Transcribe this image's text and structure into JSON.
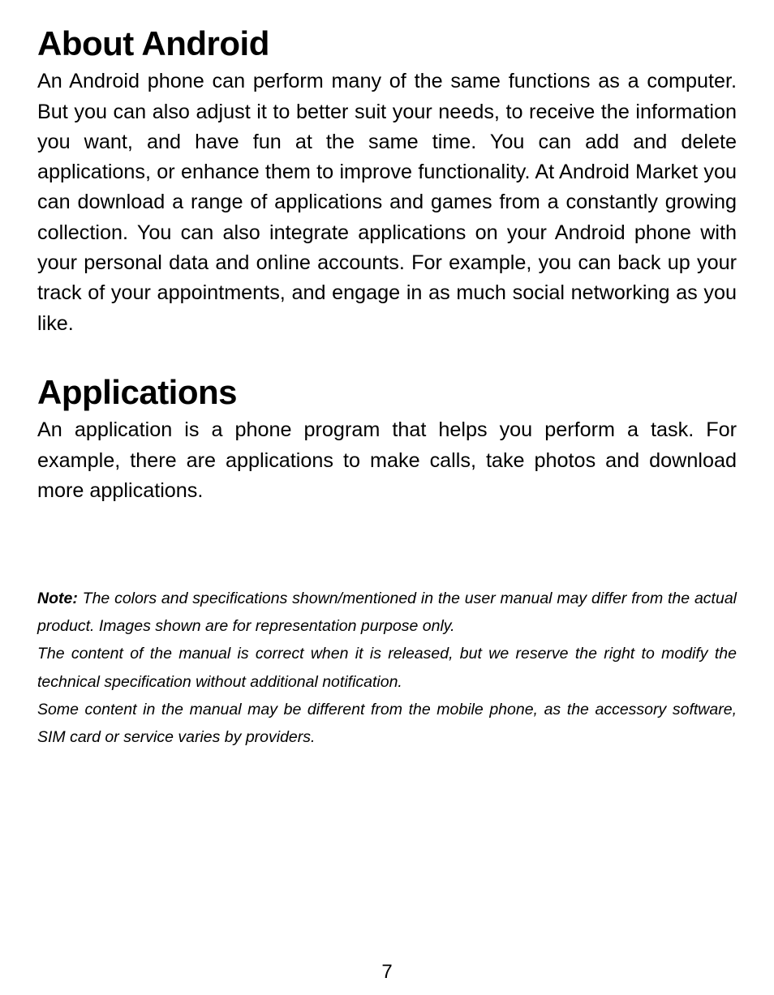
{
  "sections": [
    {
      "heading": "About Android",
      "body": "An Android phone can perform many of the same functions as a computer. But you can also adjust it to better suit your needs, to receive the information you want, and have fun at the same time. You can add and delete applications, or enhance them to improve functionality. At Android Market you can download a range of applications and games from a constantly growing collection. You can also integrate applications on your Android phone with your personal data and online accounts. For example, you can back up your track of your appointments, and engage in as much social networking as you like."
    },
    {
      "heading": "Applications",
      "body": "An application is a phone program that helps you perform a task. For example, there are applications to make calls, take photos and download more applications."
    }
  ],
  "note": {
    "label": "Note:",
    "line1": " The colors and specifications shown/mentioned in the user manual may differ from the actual product. Images shown are for representation purpose only.",
    "line2": "The content of the manual is correct when it is released, but we reserve the right to modify the technical specification without additional notification.",
    "line3": "Some content in the manual may be different from the mobile phone, as the accessory software, SIM card or service varies by providers."
  },
  "page_number": "7"
}
